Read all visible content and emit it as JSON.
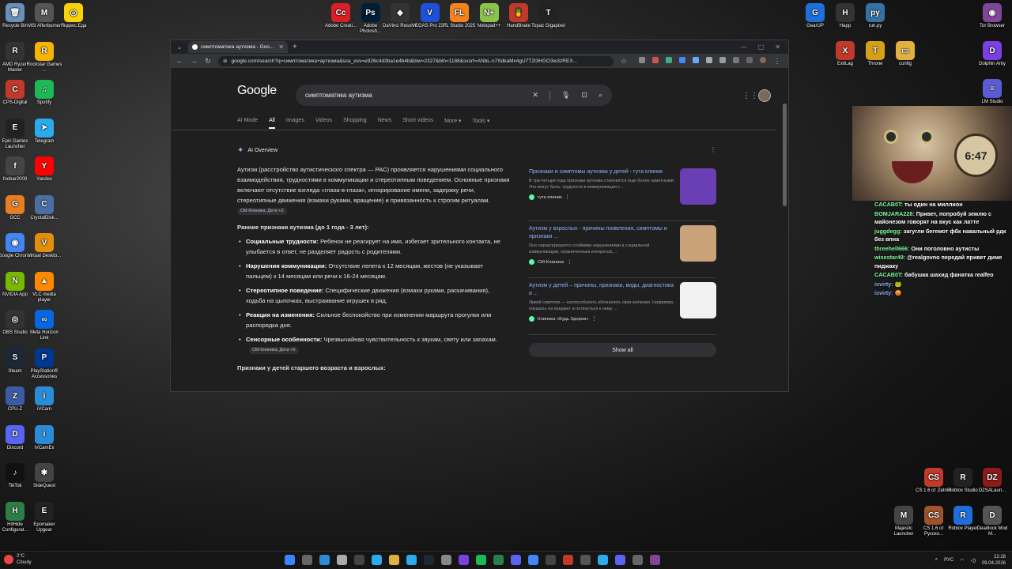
{
  "desktop": {
    "left_col1": [
      {
        "label": "Recycle Bin",
        "color": "#6a8fb8",
        "glyph": "🗑"
      },
      {
        "label": "AMD Ryzen Master",
        "color": "#333333",
        "glyph": "R"
      },
      {
        "label": "CPS-Digital",
        "color": "#c0392b",
        "glyph": "C"
      },
      {
        "label": "Epic Games Launcher",
        "color": "#222222",
        "glyph": "E"
      },
      {
        "label": "foobar2000",
        "color": "#444444",
        "glyph": "f"
      },
      {
        "label": "GCC",
        "color": "#e67e22",
        "glyph": "G"
      },
      {
        "label": "Google Chrome",
        "color": "#4285f4",
        "glyph": "◉"
      },
      {
        "label": "NVIDIA App",
        "color": "#76b900",
        "glyph": "N"
      },
      {
        "label": "OBS Studio",
        "color": "#333333",
        "glyph": "◎"
      },
      {
        "label": "Steam",
        "color": "#1b2838",
        "glyph": "S"
      },
      {
        "label": "CPU-Z",
        "color": "#3b5ba5",
        "glyph": "Z"
      },
      {
        "label": "Discord",
        "color": "#5865f2",
        "glyph": "D"
      },
      {
        "label": "TikTok",
        "color": "#111111",
        "glyph": "♪"
      },
      {
        "label": "HitHide Configurat...",
        "color": "#2d7d46",
        "glyph": "H"
      }
    ],
    "left_col2": [
      {
        "label": "MSI Afterburner",
        "color": "#555555",
        "glyph": "M"
      },
      {
        "label": "Rockstar Games ...",
        "color": "#f4b400",
        "glyph": "R"
      },
      {
        "label": "Spotify",
        "color": "#1db954",
        "glyph": "♫"
      },
      {
        "label": "Telegram",
        "color": "#2aabee",
        "glyph": "➤"
      },
      {
        "label": "Yandex",
        "color": "#ff0000",
        "glyph": "Y"
      },
      {
        "label": "CrystalDisk...",
        "color": "#4a6fa5",
        "glyph": "C"
      },
      {
        "label": "Virtual Deskto...",
        "color": "#e08e0b",
        "glyph": "V"
      },
      {
        "label": "VLC media player",
        "color": "#ff8800",
        "glyph": "▲"
      },
      {
        "label": "Meta Horizon Link",
        "color": "#0668e1",
        "glyph": "∞"
      },
      {
        "label": "PlayStation® Accessories",
        "color": "#003791",
        "glyph": "P"
      },
      {
        "label": "iVCam",
        "color": "#2b8cd6",
        "glyph": "i"
      },
      {
        "label": "iVCamEx",
        "color": "#2b8cd6",
        "glyph": "i"
      },
      {
        "label": "SideQuest",
        "color": "#444444",
        "glyph": "✱"
      },
      {
        "label": "Epomaker Upgear",
        "color": "#222222",
        "glyph": "E"
      }
    ],
    "left_col3": [
      {
        "label": "Яндекс.Еда",
        "color": "#f7d308",
        "glyph": "◎"
      }
    ],
    "top_row": [
      {
        "label": "Adobe Creati...",
        "color": "#da1f26",
        "glyph": "Cc"
      },
      {
        "label": "Adobe Photosh...",
        "color": "#001e36",
        "glyph": "Ps"
      },
      {
        "label": "DaVinci Resolve",
        "color": "#333333",
        "glyph": "◈"
      },
      {
        "label": "VEGAS Pro 23.0",
        "color": "#1e50d8",
        "glyph": "V"
      },
      {
        "label": "FL Studio 2025",
        "color": "#f58220",
        "glyph": "FL"
      },
      {
        "label": "Notepad++",
        "color": "#8bc34a",
        "glyph": "N+"
      },
      {
        "label": "HandBrake",
        "color": "#c0392b",
        "glyph": "🍍"
      },
      {
        "label": "Topaz Gigapixel",
        "color": "#222222",
        "glyph": "T"
      }
    ],
    "right_icons": [
      {
        "label": "GearUP",
        "color": "#1e6fd9",
        "glyph": "G"
      },
      {
        "label": "Happ",
        "color": "#333333",
        "glyph": "H"
      },
      {
        "label": "run.py",
        "color": "#3572a5",
        "glyph": "py"
      },
      {
        "label": "Tor Browser",
        "color": "#7e4798",
        "glyph": "◉"
      },
      {
        "label": "ExitLag",
        "color": "#c0392b",
        "glyph": "X"
      },
      {
        "label": "Throne",
        "color": "#d4a017",
        "glyph": "T"
      },
      {
        "label": "config",
        "color": "#e0b040",
        "glyph": "▭"
      },
      {
        "label": "Dolphin Anty",
        "color": "#7b3fe4",
        "glyph": "D"
      },
      {
        "label": "LM Studio",
        "color": "#5b5bd6",
        "glyph": "≡"
      }
    ],
    "bottom_right": [
      {
        "label": "CS 1.6 от Zetriks",
        "color": "#c0392b",
        "glyph": "CS"
      },
      {
        "label": "Roblox Studio",
        "color": "#222222",
        "glyph": "R"
      },
      {
        "label": "DZSALaun...",
        "color": "#8b1a1a",
        "glyph": "DZ"
      },
      {
        "label": "Majestic Launcher",
        "color": "#444444",
        "glyph": "M"
      },
      {
        "label": "CS 1.6 от Русско...",
        "color": "#a0522d",
        "glyph": "CS"
      },
      {
        "label": "Roblox Player",
        "color": "#1e6fd9",
        "glyph": "R"
      },
      {
        "label": "Deadlock Mod M...",
        "color": "#555555",
        "glyph": "D"
      }
    ]
  },
  "browser": {
    "tab_title": "симптоматика аутизма - Goo...",
    "url": "google.com/search?q=симптоматика+аутизма&sca_esv=e926c4d3ba1e4b4b&biw=2327&bih=1188&sxsrf=ANbL-n7SdkaMx4gU7T2t3HGO3w3zREX...",
    "search_query": "симптоматика аутизма",
    "logo": "Google",
    "tabs": [
      "AI Mode",
      "All",
      "Images",
      "Videos",
      "Shopping",
      "News",
      "Short videos",
      "More ▾",
      "Tools ▾"
    ],
    "ai_overview_label": "AI Overview",
    "intro": "Аутизм (расстройство аутистического спектра — РАС) проявляется нарушениями социального взаимодействия, трудностями в коммуникации и стереотипным поведением. Основные признаки включают отсутствие взгляда «глаза-в-глаза», игнорирование имени, задержку речи, стереотипные движения (взмахи руками, вращение) и привязанность к строгим ритуалам.",
    "intro_chip": "СМ-Клиника, Дети +2",
    "early_heading": "Ранние признаки аутизма (до 1 года - 3 лет):",
    "bullets": [
      {
        "title": "Социальные трудности:",
        "text": " Ребенок не реагирует на имя, избегает зрительного контакта, не улыбается в ответ, не разделяет радость с родителями."
      },
      {
        "title": "Нарушения коммуникации:",
        "text": " Отсутствие лепета к 12 месяцам, жестов (не указывает пальцем) к 14 месяцам или речи к 16-24 месяцам."
      },
      {
        "title": "Стереотипное поведение:",
        "text": " Специфические движения (взмахи руками, раскачивания), ходьба на цыпочках, выстраивание игрушек в ряд."
      },
      {
        "title": "Реакция на изменения:",
        "text": " Сильное беспокойство при изменении маршрута прогулки или распорядка дня."
      },
      {
        "title": "Сенсорные особенности:",
        "text": " Чрезвычайная чувствительность к звукам, свету или запахам."
      }
    ],
    "bullet_chip": "СМ-Клиника, Дети +5",
    "older_heading": "Признаки у детей старшего возраста и взрослых:",
    "cards": [
      {
        "title": "Признаки и симптомы аутизма у детей - гута клиник",
        "snippet": "В три-четыре года признаки аутизма становятся еще более заметными. Это могут быть: трудности в коммуникации с ...",
        "source": "гута клиник",
        "thumb": "#6a3fb5"
      },
      {
        "title": "Аутизм у взрослых - причины появления, симптомы и признаки ...",
        "snippet": "Оно характеризуется стойкими нарушениями в социальной коммуникации, ограниченным интересов,...",
        "source": "СМ-Клиника",
        "thumb": "#c9a27a"
      },
      {
        "title": "Аутизм у детей – причины, признаки, виды, диагностика и ...",
        "snippet": "Яркий симптом — неспособность обозначить свои желания. Например, показать на предмет и потянуться к нему ...",
        "source": "Клиника «Будь Здоров»",
        "thumb": "#f2f2f2"
      }
    ],
    "show_all": "Show all"
  },
  "chat": [
    {
      "name": "CACAB0T:",
      "msg": "ты один на миллион",
      "color": "#7CFC9A"
    },
    {
      "name": "BOMJARA228:",
      "msg": "Привет, попробуй землю с майонезом говорят на вкус как латте",
      "color": "#7CFC9A"
    },
    {
      "name": "juggdegg:",
      "msg": "загугли бегемот фбк навальный рдк без впна",
      "color": "#7CFC9A"
    },
    {
      "name": "threehell666:",
      "msg": "Они поголовно аутисты",
      "color": "#7CFC9A"
    },
    {
      "name": "wisestar49:",
      "msg": "@realgovno передай привет диме пиджаку",
      "color": "#7CFC9A"
    },
    {
      "name": "CACAB0T:",
      "msg": "бабушка шахид фанатка realfeo",
      "color": "#7CFC9A"
    },
    {
      "name": "isvirty:",
      "msg": "🐸",
      "color": "#8ab4f8"
    },
    {
      "name": "isvirty:",
      "msg": "😡",
      "color": "#8ab4f8"
    }
  ],
  "overlay": {
    "clock_text": "6:47"
  },
  "taskbar": {
    "temp": "2°C",
    "weather": "Cloudy",
    "lang": "РУС",
    "time": "22:28",
    "date": "09.04.2026",
    "app_colors": [
      "#3a86ff",
      "#666",
      "#2b8cd6",
      "#aaa",
      "#444",
      "#2aabee",
      "#e0b040",
      "#2aabee",
      "#1b2838",
      "#888",
      "#7b3fe4",
      "#1db954",
      "#2d7d46",
      "#5865f2",
      "#4285f4",
      "#444",
      "#c0392b",
      "#555",
      "#2aabee",
      "#5865f2",
      "#666",
      "#7e4798"
    ]
  }
}
